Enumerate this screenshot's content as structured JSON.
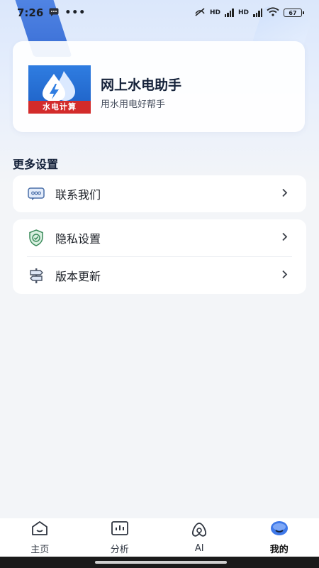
{
  "status_bar": {
    "time": "7:26",
    "battery": "67",
    "hd1": "HD",
    "hd2": "HD"
  },
  "profile": {
    "app_name": "网上水电助手",
    "slogan": "用水用电好帮手",
    "logo_text": "水电计算"
  },
  "settings": {
    "section_title": "更多设置",
    "group1": [
      {
        "label": "联系我们",
        "icon": "chat-icon"
      }
    ],
    "group2": [
      {
        "label": "隐私设置",
        "icon": "shield-check-icon"
      },
      {
        "label": "版本更新",
        "icon": "signpost-icon"
      }
    ]
  },
  "tabbar": {
    "items": [
      {
        "label": "主页",
        "icon": "home-icon"
      },
      {
        "label": "分析",
        "icon": "chart-icon"
      },
      {
        "label": "AI",
        "icon": "ai-icon"
      },
      {
        "label": "我的",
        "icon": "profile-face-icon",
        "active": true
      }
    ]
  },
  "colors": {
    "accent": "#3b74e6",
    "logo_red": "#d32b2b",
    "logo_blue": "#2f7de1"
  }
}
